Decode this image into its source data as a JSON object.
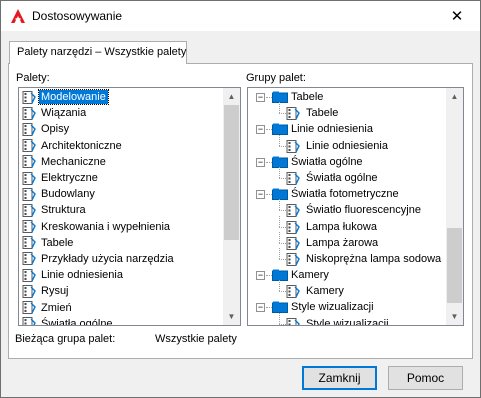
{
  "window": {
    "title": "Dostosowywanie",
    "close_glyph": "✕"
  },
  "tab": {
    "label": "Palety narzędzi – Wszystkie palety"
  },
  "palettes": {
    "label": "Palety:",
    "items": [
      {
        "label": "Modelowanie",
        "selected": true
      },
      {
        "label": "Wiązania"
      },
      {
        "label": "Opisy"
      },
      {
        "label": "Architektoniczne"
      },
      {
        "label": "Mechaniczne"
      },
      {
        "label": "Elektryczne"
      },
      {
        "label": "Budowlany"
      },
      {
        "label": "Struktura"
      },
      {
        "label": "Kreskowania i wypełnienia"
      },
      {
        "label": "Tabele"
      },
      {
        "label": "Przykłady użycia narzędzia"
      },
      {
        "label": "Linie odniesienia"
      },
      {
        "label": "Rysuj"
      },
      {
        "label": "Zmień"
      },
      {
        "label": "Światła ogólne"
      }
    ]
  },
  "groups": {
    "label": "Grupy palet:",
    "tree": [
      {
        "label": "Tabele",
        "level": 0
      },
      {
        "label": "Tabele",
        "level": 1
      },
      {
        "label": "Linie odniesienia",
        "level": 0
      },
      {
        "label": "Linie odniesienia",
        "level": 1
      },
      {
        "label": "Światła ogólne",
        "level": 0
      },
      {
        "label": "Światła ogólne",
        "level": 1
      },
      {
        "label": "Światła fotometryczne",
        "level": 0
      },
      {
        "label": "Światło fluorescencyjne",
        "level": 1
      },
      {
        "label": "Lampa łukowa",
        "level": 1
      },
      {
        "label": "Lampa żarowa",
        "level": 1
      },
      {
        "label": "Niskoprężna lampa sodowa",
        "level": 1
      },
      {
        "label": "Kamery",
        "level": 0
      },
      {
        "label": "Kamery",
        "level": 1
      },
      {
        "label": "Style wizualizacji",
        "level": 0
      },
      {
        "label": "Style wizualizacji",
        "level": 1
      }
    ],
    "expander_glyph": "−"
  },
  "current_group": {
    "label": "Bieżąca grupa palet:",
    "value": "Wszystkie palety"
  },
  "buttons": {
    "close": "Zamknij",
    "help": "Pomoc"
  },
  "scrollbar": {
    "up_glyph": "▲",
    "down_glyph": "▼"
  },
  "colors": {
    "selection": "#0078d7",
    "folder_blue": "#0078d7",
    "app_icon_red": "#e11b22"
  }
}
